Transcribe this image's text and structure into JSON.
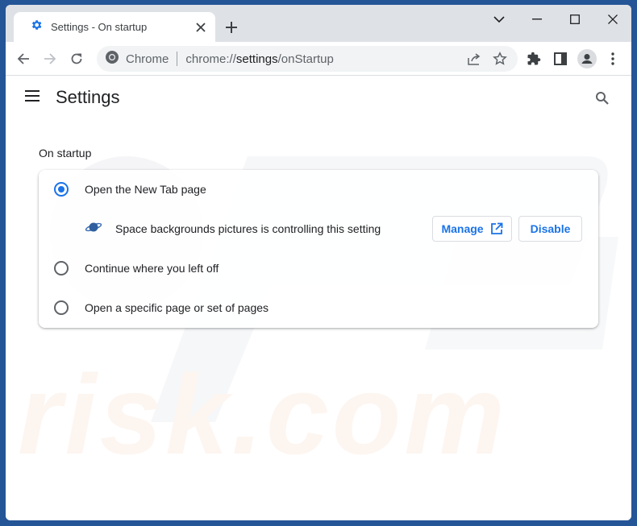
{
  "browser": {
    "tab": {
      "title": "Settings - On startup",
      "icon": "gear-icon"
    },
    "new_tab_symbol": "+",
    "omnibox": {
      "site_label": "Chrome",
      "url_prefix": "chrome://",
      "url_bold": "settings",
      "url_suffix": "/onStartup"
    }
  },
  "page": {
    "title": "Settings",
    "section_title": "On startup",
    "options": [
      {
        "label": "Open the New Tab page",
        "checked": true
      },
      {
        "label": "Continue where you left off",
        "checked": false
      },
      {
        "label": "Open a specific page or set of pages",
        "checked": false
      }
    ],
    "extension_notice": {
      "text": "Space backgrounds pictures is controlling this setting",
      "manage_label": "Manage",
      "disable_label": "Disable"
    }
  },
  "watermark": {
    "text": "risk.com"
  },
  "colors": {
    "accent": "#1a73e8",
    "frame": "#245596",
    "tabstrip": "#dee1e6"
  }
}
